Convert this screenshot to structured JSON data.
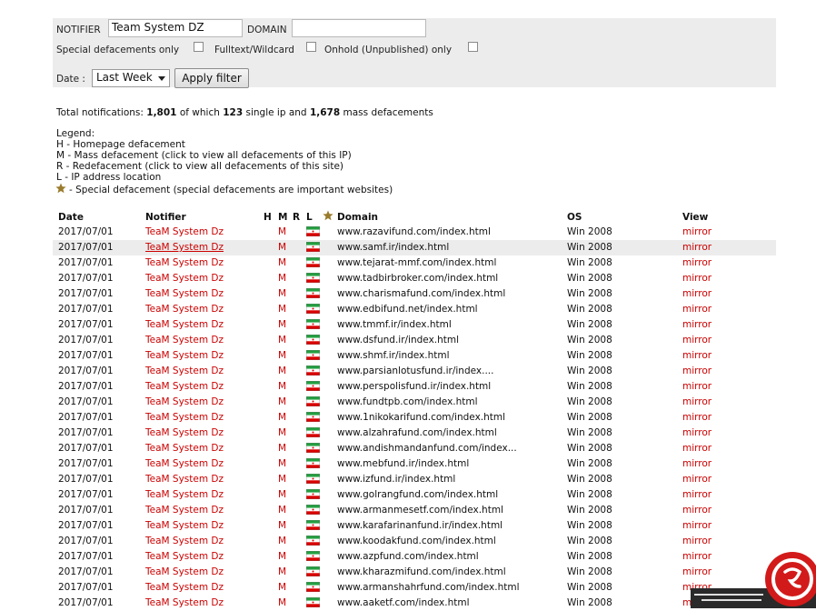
{
  "filter": {
    "notifier_label": "NOTIFIER",
    "notifier_value": "Team System DZ",
    "domain_label": "DOMAIN",
    "domain_value": "",
    "special_label": "Special defacements only",
    "fulltext_label": "Fulltext/Wildcard",
    "onhold_label": "Onhold (Unpublished) only",
    "date_label": "Date :",
    "date_selected": "Last Week",
    "apply_label": "Apply filter"
  },
  "summary": {
    "prefix": "Total notifications:",
    "total": "1,801",
    "of_which": "of which",
    "single": "123",
    "single_ip_and": "single ip and",
    "mass": "1,678",
    "mass_suffix": "mass defacements"
  },
  "legend": {
    "title": "Legend:",
    "h": "H - Homepage defacement",
    "m": "M - Mass defacement (click to view all defacements of this IP)",
    "r": "R - Redefacement (click to view all defacements of this site)",
    "l": "L - IP address location",
    "special": "- Special defacement (special defacements are important websites)"
  },
  "table": {
    "headers": {
      "date": "Date",
      "notifier": "Notifier",
      "h": "H",
      "m": "M",
      "r": "R",
      "l": "L",
      "domain": "Domain",
      "os": "OS",
      "view": "View"
    },
    "rows": [
      {
        "date": "2017/07/01",
        "notifier": "TeaM System Dz",
        "m": "M",
        "domain": "www.razavifund.com/index.html",
        "os": "Win 2008",
        "view": "mirror"
      },
      {
        "date": "2017/07/01",
        "notifier": "TeaM System Dz",
        "m": "M",
        "domain": "www.samf.ir/index.html",
        "os": "Win 2008",
        "view": "mirror"
      },
      {
        "date": "2017/07/01",
        "notifier": "TeaM System Dz",
        "m": "M",
        "domain": "www.tejarat-mmf.com/index.html",
        "os": "Win 2008",
        "view": "mirror"
      },
      {
        "date": "2017/07/01",
        "notifier": "TeaM System Dz",
        "m": "M",
        "domain": "www.tadbirbroker.com/index.html",
        "os": "Win 2008",
        "view": "mirror"
      },
      {
        "date": "2017/07/01",
        "notifier": "TeaM System Dz",
        "m": "M",
        "domain": "www.charismafund.com/index.html",
        "os": "Win 2008",
        "view": "mirror"
      },
      {
        "date": "2017/07/01",
        "notifier": "TeaM System Dz",
        "m": "M",
        "domain": "www.edbifund.net/index.html",
        "os": "Win 2008",
        "view": "mirror"
      },
      {
        "date": "2017/07/01",
        "notifier": "TeaM System Dz",
        "m": "M",
        "domain": "www.tmmf.ir/index.html",
        "os": "Win 2008",
        "view": "mirror"
      },
      {
        "date": "2017/07/01",
        "notifier": "TeaM System Dz",
        "m": "M",
        "domain": "www.dsfund.ir/index.html",
        "os": "Win 2008",
        "view": "mirror"
      },
      {
        "date": "2017/07/01",
        "notifier": "TeaM System Dz",
        "m": "M",
        "domain": "www.shmf.ir/index.html",
        "os": "Win 2008",
        "view": "mirror"
      },
      {
        "date": "2017/07/01",
        "notifier": "TeaM System Dz",
        "m": "M",
        "domain": "www.parsianlotusfund.ir/index....",
        "os": "Win 2008",
        "view": "mirror"
      },
      {
        "date": "2017/07/01",
        "notifier": "TeaM System Dz",
        "m": "M",
        "domain": "www.perspolisfund.ir/index.html",
        "os": "Win 2008",
        "view": "mirror"
      },
      {
        "date": "2017/07/01",
        "notifier": "TeaM System Dz",
        "m": "M",
        "domain": "www.fundtpb.com/index.html",
        "os": "Win 2008",
        "view": "mirror"
      },
      {
        "date": "2017/07/01",
        "notifier": "TeaM System Dz",
        "m": "M",
        "domain": "www.1nikokarifund.com/index.html",
        "os": "Win 2008",
        "view": "mirror"
      },
      {
        "date": "2017/07/01",
        "notifier": "TeaM System Dz",
        "m": "M",
        "domain": "www.alzahrafund.com/index.html",
        "os": "Win 2008",
        "view": "mirror"
      },
      {
        "date": "2017/07/01",
        "notifier": "TeaM System Dz",
        "m": "M",
        "domain": "www.andishmandanfund.com/index...",
        "os": "Win 2008",
        "view": "mirror"
      },
      {
        "date": "2017/07/01",
        "notifier": "TeaM System Dz",
        "m": "M",
        "domain": "www.mebfund.ir/index.html",
        "os": "Win 2008",
        "view": "mirror"
      },
      {
        "date": "2017/07/01",
        "notifier": "TeaM System Dz",
        "m": "M",
        "domain": "www.izfund.ir/index.html",
        "os": "Win 2008",
        "view": "mirror"
      },
      {
        "date": "2017/07/01",
        "notifier": "TeaM System Dz",
        "m": "M",
        "domain": "www.golrangfund.com/index.html",
        "os": "Win 2008",
        "view": "mirror"
      },
      {
        "date": "2017/07/01",
        "notifier": "TeaM System Dz",
        "m": "M",
        "domain": "www.armanmesetf.com/index.html",
        "os": "Win 2008",
        "view": "mirror"
      },
      {
        "date": "2017/07/01",
        "notifier": "TeaM System Dz",
        "m": "M",
        "domain": "www.karafarinanfund.ir/index.html",
        "os": "Win 2008",
        "view": "mirror"
      },
      {
        "date": "2017/07/01",
        "notifier": "TeaM System Dz",
        "m": "M",
        "domain": "www.koodakfund.com/index.html",
        "os": "Win 2008",
        "view": "mirror"
      },
      {
        "date": "2017/07/01",
        "notifier": "TeaM System Dz",
        "m": "M",
        "domain": "www.azpfund.com/index.html",
        "os": "Win 2008",
        "view": "mirror"
      },
      {
        "date": "2017/07/01",
        "notifier": "TeaM System Dz",
        "m": "M",
        "domain": "www.kharazmifund.com/index.html",
        "os": "Win 2008",
        "view": "mirror"
      },
      {
        "date": "2017/07/01",
        "notifier": "TeaM System Dz",
        "m": "M",
        "domain": "www.armanshahrfund.com/index.html",
        "os": "Win 2008",
        "view": "mirror"
      },
      {
        "date": "2017/07/01",
        "notifier": "TeaM System Dz",
        "m": "M",
        "domain": "www.aaketf.com/index.html",
        "os": "Win 2008",
        "view": "mirror"
      }
    ]
  },
  "watermark": {
    "text": "باشگاه خبرنگاران"
  },
  "colors": {
    "link_red": "#cc0000",
    "panel_bg": "#ececec",
    "star_gold": "#9a7b2c",
    "watermark_red": "#d31a1a"
  },
  "icons": {
    "flag": "iran-flag-icon",
    "special": "star-icon",
    "select": "chevron-down-icon"
  }
}
